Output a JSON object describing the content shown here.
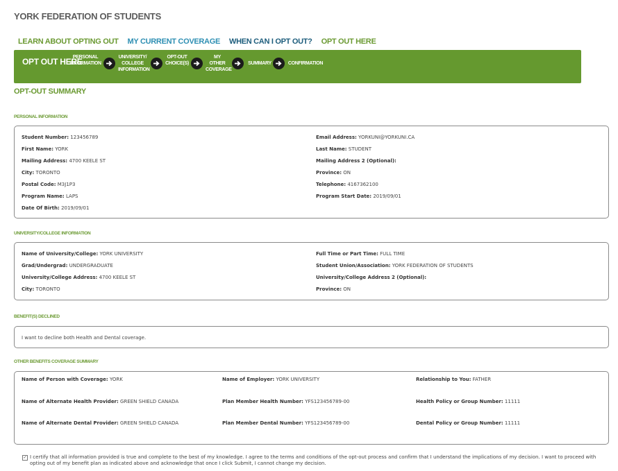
{
  "org_title": "YORK FEDERATION OF STUDENTS",
  "nav": [
    "LEARN ABOUT OPTING OUT",
    "MY CURRENT COVERAGE",
    "WHEN CAN I OPT OUT?",
    "OPT OUT HERE"
  ],
  "progress": {
    "title": "OPT OUT HERE",
    "steps": [
      "PERSONAL INFORMATION",
      "UNIVERSITY/ COLLEGE INFORMATION",
      "OPT-OUT CHOICE(S)",
      "MY OTHER COVERAGE",
      "SUMMARY",
      "CONFIRMATION"
    ]
  },
  "summary_title": "OPT-OUT SUMMARY",
  "personal": {
    "heading": "PERSONAL INFORMATION",
    "rows": [
      {
        "label": "Student Number:",
        "value": "123456789"
      },
      {
        "label": "Email Address:",
        "value": "YORKUNI@YORKUNI.CA"
      },
      {
        "label": "First Name:",
        "value": "YORK"
      },
      {
        "label": "Last Name:",
        "value": "STUDENT"
      },
      {
        "label": "Mailing Address:",
        "value": "4700 KEELE ST"
      },
      {
        "label": "Mailing Address 2 (Optional):",
        "value": ""
      },
      {
        "label": "City:",
        "value": "TORONTO"
      },
      {
        "label": "Province:",
        "value": "ON"
      },
      {
        "label": "Postal Code:",
        "value": "M3J1P3"
      },
      {
        "label": "Telephone:",
        "value": "4167362100"
      },
      {
        "label": "Program Name:",
        "value": "LAPS"
      },
      {
        "label": "Program Start Date:",
        "value": "2019/09/01"
      },
      {
        "label": "Date Of Birth:",
        "value": "2019/09/01"
      }
    ]
  },
  "university": {
    "heading": "UNIVERSITY/COLLEGE INFORMATION",
    "rows": [
      {
        "label": "Name of University/College:",
        "value": "YORK UNIVERSITY"
      },
      {
        "label": "Full Time or Part Time:",
        "value": "FULL TIME"
      },
      {
        "label": "Grad/Undergrad:",
        "value": "UNDERGRADUATE"
      },
      {
        "label": "Student Union/Association:",
        "value": "YORK FEDERATION OF STUDENTS"
      },
      {
        "label": "University/College Address:",
        "value": "4700 KEELE ST"
      },
      {
        "label": "University/College Address 2 (Optional):",
        "value": ""
      },
      {
        "label": "City:",
        "value": "TORONTO"
      },
      {
        "label": "Province:",
        "value": "ON"
      }
    ]
  },
  "benefits": {
    "heading": "BENEFIT(S) DECLINED",
    "text": "I want to decline both Health and Dental coverage."
  },
  "other": {
    "heading": "OTHER BENEFITS COVERAGE SUMMARY",
    "rows": [
      {
        "label": "Name of Person with Coverage:",
        "value": "YORK"
      },
      {
        "label": "Name of Employer:",
        "value": "YORK UNIVERSITY"
      },
      {
        "label": "Relationship to You:",
        "value": "FATHER"
      },
      {
        "label": "Name of Alternate Health Provider:",
        "value": "GREEN SHIELD CANADA"
      },
      {
        "label": "Plan Member Health Number:",
        "value": "YFS123456789-00"
      },
      {
        "label": "Health Policy or Group Number:",
        "value": "11111"
      },
      {
        "label": "Name of Alternate Dental Provider:",
        "value": "GREEN SHIELD CANADA"
      },
      {
        "label": "Plan Member Dental Number:",
        "value": "YFS123456789-00"
      },
      {
        "label": "Dental Policy or Group Number:",
        "value": "11111"
      }
    ]
  },
  "certify": {
    "checked": true,
    "text": "I certify that all information provided is true and complete to the best of my knowledge. I agree to the terms and conditions of the opt-out process and confirm that I understand the implications of my decision. I want to proceed with opting out of my benefit plan as indicated above and acknowledge that once I click Submit, I cannot change my decision."
  }
}
